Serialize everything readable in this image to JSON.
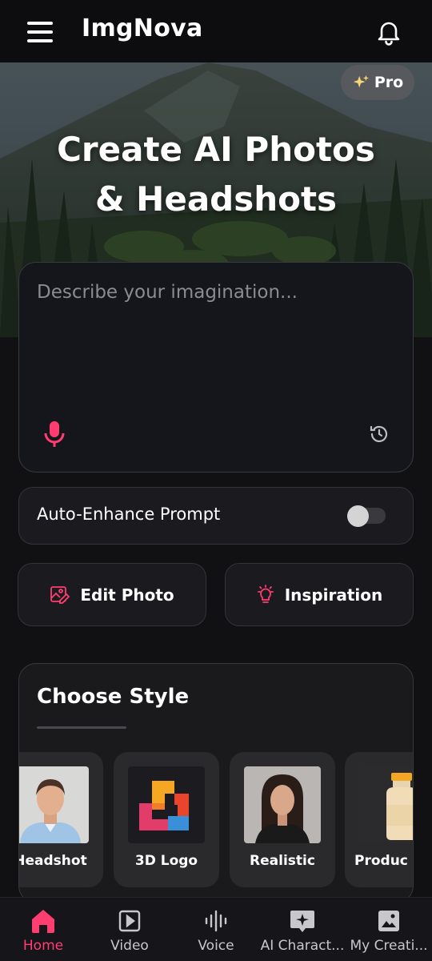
{
  "header": {
    "app_title": "ImgNova",
    "menu_icon": "hamburger-menu-icon",
    "notification_icon": "bell-icon"
  },
  "hero": {
    "pro_label": "Pro",
    "pro_icon": "sparkles-icon",
    "title_line1": "Create AI Photos",
    "title_line2": "& Headshots"
  },
  "prompt": {
    "placeholder": "Describe your imagination...",
    "mic_icon": "microphone-icon",
    "history_icon": "history-icon"
  },
  "enhance": {
    "label": "Auto-Enhance Prompt",
    "enabled": false
  },
  "actions": {
    "edit_photo": "Edit Photo",
    "inspiration": "Inspiration"
  },
  "styles": {
    "title": "Choose Style",
    "items": [
      {
        "label": "Headshot"
      },
      {
        "label": "3D Logo"
      },
      {
        "label": "Realistic"
      },
      {
        "label": "Produc"
      }
    ]
  },
  "nav": {
    "items": [
      {
        "label": "Home",
        "icon": "home-icon"
      },
      {
        "label": "Video",
        "icon": "video-play-icon"
      },
      {
        "label": "Voice",
        "icon": "voice-wave-icon"
      },
      {
        "label": "AI Charact...",
        "icon": "ai-character-chat-icon"
      },
      {
        "label": "My Creati...",
        "icon": "image-gallery-icon"
      }
    ]
  },
  "colors": {
    "accent": "#ff3d71",
    "background": "#111113",
    "card": "#1b1b1f"
  }
}
